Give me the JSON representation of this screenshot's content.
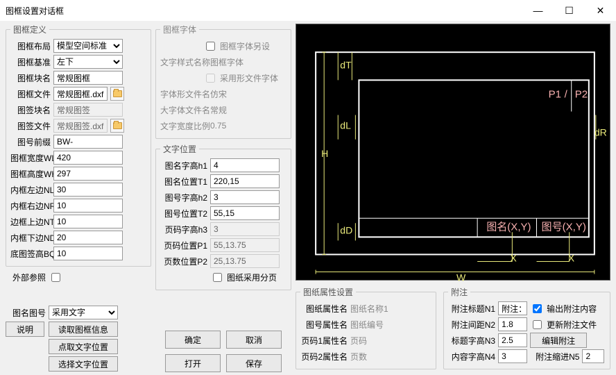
{
  "window": {
    "title": "图框设置对话框",
    "min": "—",
    "max": "☐",
    "close": "✕"
  },
  "def": {
    "legend": "图框定义",
    "layout_l": "图框布局",
    "layout_v": "模型空间标准",
    "base_l": "图框基准",
    "base_v": "左下",
    "block_l": "图框块名",
    "block_v": "常规图框",
    "file_l": "图框文件",
    "file_v": "常规图框.dxf",
    "tbblock_l": "图签块名",
    "tbblock_v": "常规图签",
    "tbfile_l": "图签文件",
    "tbfile_v": "常规图签.dxf",
    "prefix_l": "图号前缀",
    "prefix_v": "BW-",
    "wl_l": "图框宽度WL",
    "wl_v": "420",
    "wh_l": "图框高度WH",
    "wh_v": "297",
    "nl_l": "内框左边NL",
    "nl_v": "30",
    "nr_l": "内框右边NR",
    "nr_v": "10",
    "nt_l": "边框上边NT",
    "nt_v": "10",
    "nd_l": "内框下边ND",
    "nd_v": "20",
    "bq_l": "底图签高BQ",
    "bq_v": "10",
    "ext_l": "外部参照"
  },
  "font": {
    "legend": "图框字体",
    "sep_l": "图框字体另设",
    "style_l": "文字样式名称",
    "style_v": "图框字体",
    "shape_l": "采用形文件字体",
    "shp_l": "字体形文件名",
    "shp_v": "仿宋",
    "big_l": "大字体文件名",
    "big_v": "常规",
    "ratio_l": "文字宽度比例",
    "ratio_v": "0.75"
  },
  "txtpos": {
    "legend": "文字位置",
    "h1_l": "图名字高h1",
    "h1_v": "4",
    "t1_l": "图名位置T1",
    "t1_v": "220,15",
    "h2_l": "图号字高h2",
    "h2_v": "3",
    "t2_l": "图号位置T2",
    "t2_v": "55,15",
    "h3_l": "页码字高h3",
    "h3_v": "3",
    "p1_l": "页码位置P1",
    "p1_v": "55,13.75",
    "p2_l": "页数位置P2",
    "p2_v": "25,13.75",
    "paging_l": "图纸采用分页"
  },
  "bottom": {
    "tmmode_l": "图名图号",
    "tmmode_v": "采用文字",
    "help": "说明",
    "readinfo": "读取图框信息",
    "clicktext": "点取文字位置",
    "seltext": "选择文字位置",
    "ok": "确定",
    "cancel": "取消",
    "open": "打开",
    "save": "保存"
  },
  "attr": {
    "legend": "图纸属性设置",
    "name_l": "图纸属性名",
    "name_v": "图纸名称1",
    "num_l": "图号属性名",
    "num_v": "图纸编号",
    "p1_l": "页码1属性名",
    "p1_v": "页码",
    "p2_l": "页码2属性名",
    "p2_v": "页数"
  },
  "anno": {
    "legend": "附注",
    "title_l": "附注标题N1",
    "title_v": "附注：",
    "gap_l": "附注间距N2",
    "gap_v": "1.8",
    "th_l": "标题字高N3",
    "th_v": "2.5",
    "ch_l": "内容字高N4",
    "ch_v": "3",
    "out_l": "输出附注内容",
    "upd_l": "更新附注文件",
    "edit": "编辑附注",
    "indent_l": "附注缩进N5",
    "indent_v": "2"
  },
  "preview": {
    "H": "H",
    "W": "W",
    "dT": "dT",
    "dL": "dL",
    "dD": "dD",
    "dR": "dR",
    "P1": "P1",
    "P2": "P2",
    "tm": "图名(X,Y)",
    "th": "图号(X,Y)",
    "X": "X"
  }
}
